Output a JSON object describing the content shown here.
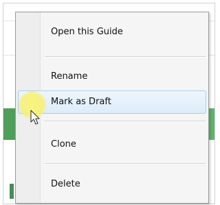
{
  "context_menu": {
    "items": [
      {
        "label": "Open this Guide",
        "state": "normal"
      },
      {
        "label": "Rename",
        "state": "normal"
      },
      {
        "label": "Mark as Draft",
        "state": "hover"
      },
      {
        "label": "Clone",
        "state": "normal"
      },
      {
        "label": "Delete",
        "state": "normal"
      }
    ]
  },
  "colors": {
    "menu_background": "#f5f5f5",
    "hover_background": "#dcecfa",
    "hover_border": "#a8cdee",
    "background_row_green": "#5fb36a",
    "cursor_highlight": "#f8f07a"
  },
  "icons": {
    "pointer": "arrow-cursor-icon",
    "cursor_highlight": "cursor-highlight-halo"
  }
}
